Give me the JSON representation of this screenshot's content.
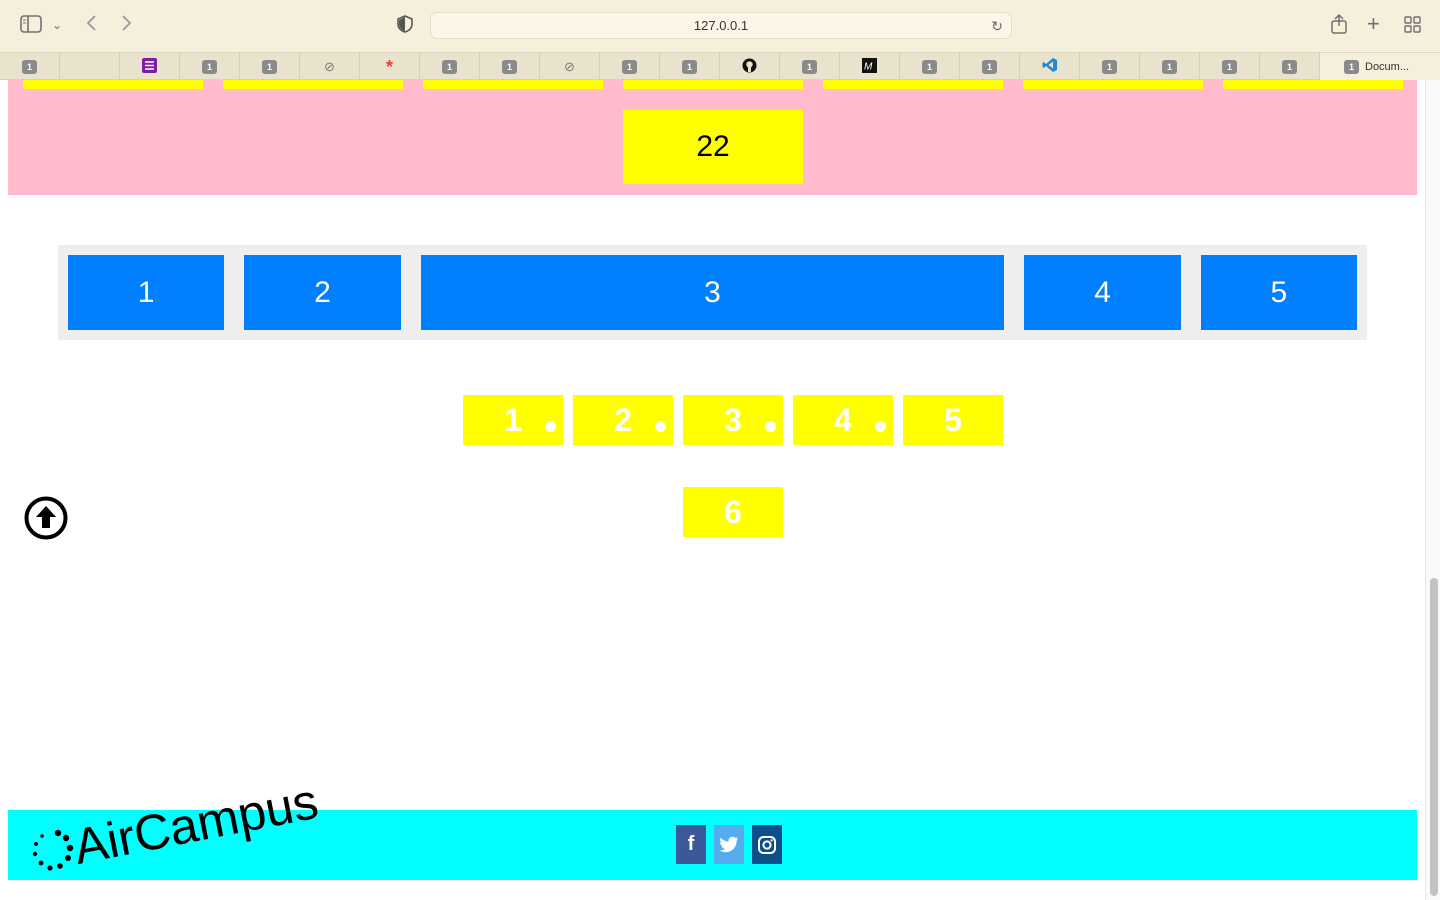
{
  "browser": {
    "url": "127.0.0.1",
    "tabs": [
      {
        "badge": "1",
        "favicon": "number-badge"
      },
      {
        "badge": "",
        "favicon": "none"
      },
      {
        "badge": "",
        "favicon": "purple-list-icon"
      },
      {
        "badge": "1",
        "favicon": "number-badge"
      },
      {
        "badge": "1",
        "favicon": "number-badge"
      },
      {
        "badge": "",
        "favicon": "compass-icon"
      },
      {
        "badge": "",
        "favicon": "asterisk-icon"
      },
      {
        "badge": "1",
        "favicon": "number-badge"
      },
      {
        "badge": "1",
        "favicon": "number-badge"
      },
      {
        "badge": "",
        "favicon": "compass-icon"
      },
      {
        "badge": "1",
        "favicon": "number-badge"
      },
      {
        "badge": "1",
        "favicon": "number-badge"
      },
      {
        "badge": "",
        "favicon": "github-icon"
      },
      {
        "badge": "1",
        "favicon": "number-badge"
      },
      {
        "badge": "",
        "favicon": "medium-icon"
      },
      {
        "badge": "1",
        "favicon": "number-badge"
      },
      {
        "badge": "1",
        "favicon": "number-badge"
      },
      {
        "badge": "",
        "favicon": "vscode-icon"
      },
      {
        "badge": "1",
        "favicon": "number-badge"
      },
      {
        "badge": "1",
        "favicon": "number-badge"
      },
      {
        "badge": "1",
        "favicon": "number-badge"
      },
      {
        "badge": "1",
        "favicon": "number-badge"
      }
    ],
    "active_tab": {
      "badge": "1",
      "label": "Docum..."
    }
  },
  "page": {
    "pink_section": {
      "box_label": "22"
    },
    "flex_items": [
      "1",
      "2",
      "3",
      "4",
      "5"
    ],
    "yellow_row": [
      "1",
      "2",
      "3",
      "4",
      "5"
    ],
    "yellow_extra": "6",
    "footer": {
      "logo_text": "AirCampus",
      "social": [
        {
          "name": "facebook",
          "glyph": "f"
        },
        {
          "name": "twitter",
          "glyph": "t"
        },
        {
          "name": "instagram",
          "glyph": "◎"
        }
      ]
    }
  },
  "colors": {
    "pink": "#ffbbcc",
    "yellow": "#ffff00",
    "blue": "#0080ff",
    "cyan": "#00ffff",
    "facebook": "#3b5998",
    "twitter": "#55acee",
    "instagram": "#0d4f8b"
  }
}
